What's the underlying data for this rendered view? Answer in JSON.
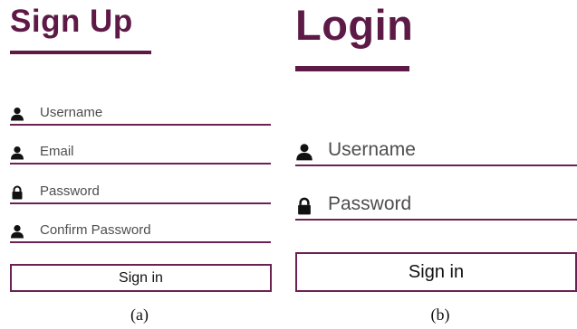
{
  "signup": {
    "title": "Sign Up",
    "fields": [
      {
        "label": "Username",
        "icon": "user-icon"
      },
      {
        "label": "Email",
        "icon": "user-icon"
      },
      {
        "label": "Password",
        "icon": "lock-icon"
      },
      {
        "label": "Confirm Password",
        "icon": "user-icon"
      }
    ],
    "button_label": "Sign in",
    "caption": "(a)"
  },
  "login": {
    "title": "Login",
    "fields": [
      {
        "label": "Username",
        "icon": "user-icon"
      },
      {
        "label": "Password",
        "icon": "lock-icon"
      }
    ],
    "button_label": "Sign in",
    "caption": "(b)"
  },
  "colors": {
    "accent": "#5e1a46",
    "underline": "#6b2253"
  }
}
